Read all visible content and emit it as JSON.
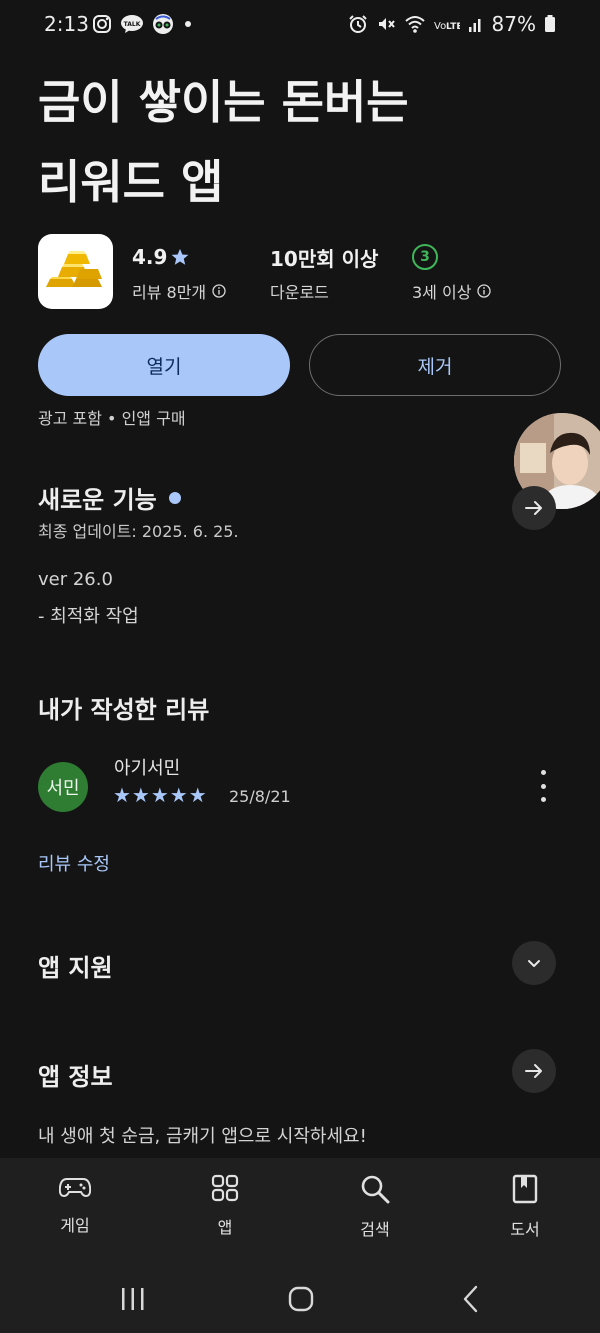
{
  "status_bar": {
    "time": "2:13",
    "battery": "87%",
    "icons_left": [
      "instagram-icon",
      "kakaotalk-icon",
      "tripadvisor-icon",
      "notification-dot-icon"
    ],
    "icons_right": [
      "alarm-icon",
      "mute-icon",
      "wifi-icon",
      "volte-icon",
      "signal-icon",
      "battery-icon"
    ]
  },
  "app": {
    "title_line1": "금이 쌓이는 돈버는",
    "title_line2": "리워드 앱",
    "icon": "gold-bars-icon",
    "rating": "4.9",
    "reviews_label": "리뷰 8만개",
    "downloads": "10만회 이상",
    "downloads_label": "다운로드",
    "content_rating": "3",
    "age_label": "3세 이상"
  },
  "buttons": {
    "open": "열기",
    "remove": "제거"
  },
  "ad_note": "광고 포함 • 인앱 구매",
  "whats_new": {
    "title": "새로운 기능",
    "updated": "최종 업데이트: 2025. 6. 25.",
    "version": "ver 26.0",
    "notes": "- 최적화 작업"
  },
  "my_review": {
    "title": "내가 작성한 리뷰",
    "avatar_text": "서민",
    "name": "아기서민",
    "stars": "★★★★★",
    "rating_value": 5,
    "date": "25/8/21",
    "edit_label": "리뷰 수정"
  },
  "app_support": {
    "title": "앱 지원"
  },
  "app_info": {
    "title": "앱 정보",
    "description": "내 생애 첫 순금, 금캐기 앱으로 시작하세요!"
  },
  "bottom_nav": [
    {
      "label": "게임",
      "icon": "gamepad-icon"
    },
    {
      "label": "앱",
      "icon": "apps-grid-icon"
    },
    {
      "label": "검색",
      "icon": "search-icon"
    },
    {
      "label": "도서",
      "icon": "book-icon"
    }
  ],
  "colors": {
    "background": "#141414",
    "accent": "#a9c7f9",
    "rating_green": "#3fb65a",
    "avatar_green": "#2e7d32"
  }
}
